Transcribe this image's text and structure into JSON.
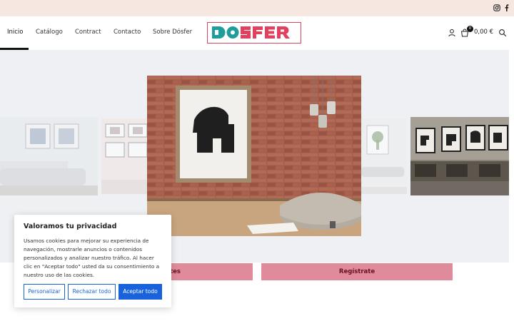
{
  "topbar": {
    "social": [
      "instagram-icon",
      "facebook-icon"
    ]
  },
  "nav": {
    "items": [
      {
        "label": "Inicio",
        "active": true
      },
      {
        "label": "Catálogo"
      },
      {
        "label": "Contract"
      },
      {
        "label": "Contacto"
      },
      {
        "label": "Sobre Dósfer"
      }
    ]
  },
  "logo": {
    "text": "DOSFER",
    "colors": {
      "teal": "#1f9c9c",
      "red": "#e2405f"
    }
  },
  "header_right": {
    "cart_count": "0",
    "cart_total": "0,00 €",
    "icons": [
      "user-icon",
      "cart-icon",
      "search-icon"
    ]
  },
  "buttons": {
    "left_partial": "tes",
    "register": "Regístrate"
  },
  "cookie": {
    "title": "Valoramos tu privacidad",
    "body": "Usamos cookies para mejorar su experiencia de navegación, mostrarle anuncios o contenidos personalizados y analizar nuestro tráfico. Al hacer clic en \"Aceptar todo\" usted da su consentimiento a nuestro uso de las cookies.",
    "customize": "Personalizar",
    "reject": "Rechazar todo",
    "accept": "Aceptar todo"
  },
  "colors": {
    "accent_pink": "#df8b9c",
    "cookie_blue": "#1863dc",
    "topbar_bg": "#f6e7e0"
  }
}
